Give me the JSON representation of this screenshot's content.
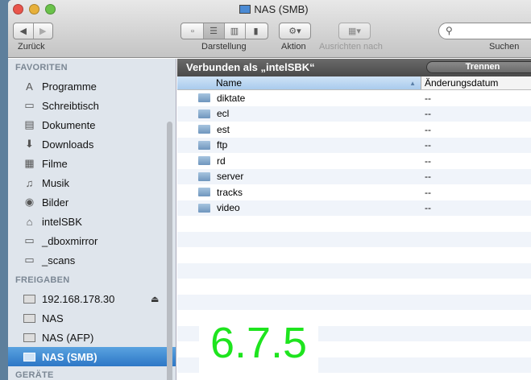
{
  "window": {
    "title": "NAS (SMB)"
  },
  "toolbar": {
    "back_label": "Zurück",
    "view_label": "Darstellung",
    "action_label": "Aktion",
    "arrange_label": "Ausrichten nach",
    "search_label": "Suchen",
    "search_placeholder": ""
  },
  "sidebar": {
    "favorites_header": "FAVORITEN",
    "favorites": [
      {
        "label": "Programme",
        "icon": "A"
      },
      {
        "label": "Schreibtisch",
        "icon": "▭"
      },
      {
        "label": "Dokumente",
        "icon": "▤"
      },
      {
        "label": "Downloads",
        "icon": "⬇"
      },
      {
        "label": "Filme",
        "icon": "▦"
      },
      {
        "label": "Musik",
        "icon": "♫"
      },
      {
        "label": "Bilder",
        "icon": "◉"
      },
      {
        "label": "intelSBK",
        "icon": "⌂"
      },
      {
        "label": "_dboxmirror",
        "icon": "▭"
      },
      {
        "label": "_scans",
        "icon": "▭"
      }
    ],
    "shares_header": "FREIGABEN",
    "shares": [
      {
        "label": "192.168.178.30"
      },
      {
        "label": "NAS"
      },
      {
        "label": "NAS (AFP)"
      },
      {
        "label": "NAS (SMB)"
      }
    ],
    "devices_header": "GERÄTE"
  },
  "content": {
    "connected_label": "Verbunden als „intelSBK“",
    "disconnect_label": "Trennen",
    "columns": {
      "name": "Name",
      "date": "Änderungsdatum"
    },
    "rows": [
      {
        "name": "diktate",
        "date": "--"
      },
      {
        "name": "ecl",
        "date": "--"
      },
      {
        "name": "est",
        "date": "--"
      },
      {
        "name": "ftp",
        "date": "--"
      },
      {
        "name": "rd",
        "date": "--"
      },
      {
        "name": "server",
        "date": "--"
      },
      {
        "name": "tracks",
        "date": "--"
      },
      {
        "name": "video",
        "date": "--"
      }
    ]
  },
  "overlay": {
    "version": "6.7.5"
  }
}
